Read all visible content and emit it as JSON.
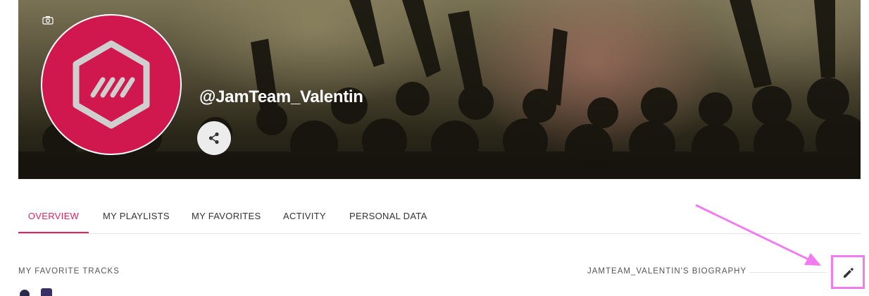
{
  "profile": {
    "username": "@JamTeam_Valentin",
    "avatar_color": "#d0184e",
    "icons": {
      "camera": "camera-icon",
      "share": "share-icon",
      "logo": "hexagon-stripes-logo"
    }
  },
  "tabs": [
    {
      "label": "OVERVIEW",
      "active": true
    },
    {
      "label": "MY PLAYLISTS",
      "active": false
    },
    {
      "label": "MY FAVORITES",
      "active": false
    },
    {
      "label": "ACTIVITY",
      "active": false
    },
    {
      "label": "PERSONAL DATA",
      "active": false
    }
  ],
  "overview": {
    "favorite_tracks_title": "MY FAVORITE TRACKS",
    "biography_title": "JAMTEAM_VALENTIN'S BIOGRAPHY",
    "edit_icon": "pencil-icon"
  },
  "colors": {
    "accent": "#e0245e",
    "highlight": "#f07cf0"
  }
}
